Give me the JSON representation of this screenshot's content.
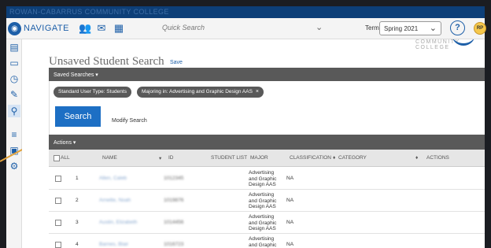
{
  "titlebar": {
    "college": "ROWAN-CABARRUS COMMUNITY COLLEGE"
  },
  "nav": {
    "label": "NAVIGATE",
    "icons": [
      "people-icon",
      "mail-icon",
      "calendar-icon"
    ],
    "quick_search": "Quick Search",
    "terms_label": "Terms",
    "term_value": "Spring 2021",
    "help": "?",
    "avatar": "RP"
  },
  "rail": [
    "dashboard-icon",
    "inbox-icon",
    "history-icon",
    "pin-icon",
    "search-icon",
    "list-icon",
    "reports-icon",
    "settings-icon"
  ],
  "page": {
    "title": "Unsaved Student Search",
    "save": "Save",
    "logo_text": "COMMUNITY COLLEGE",
    "saved_searches": "Saved Searches ▾",
    "chips": [
      {
        "label": "Standard User Type: Students"
      },
      {
        "label": "Majoring in: Advertising and Graphic Design AAS",
        "close": "×"
      }
    ],
    "search_button": "Search",
    "modify_search": "Modify Search",
    "actions": "Actions ▾"
  },
  "table": {
    "headers": {
      "all": "ALL",
      "name": "NAME",
      "sort": "▾",
      "id": "ID",
      "student_list": "STUDENT LIST",
      "major": "MAJOR",
      "classification": "CLASSIFICATION",
      "classification_sort": "♦",
      "category": "CATEGORY",
      "category_sort": "♦",
      "actions": "ACTIONS"
    },
    "rows": [
      {
        "num": "1",
        "name": "Allen, Caleb",
        "id": "1012345",
        "major": [
          "Advertising",
          "and Graphic",
          "Design AAS"
        ],
        "classification": "NA"
      },
      {
        "num": "2",
        "name": "Arnette, Noah",
        "id": "1019876",
        "major": [
          "Advertising",
          "and Graphic",
          "Design AAS"
        ],
        "classification": "NA"
      },
      {
        "num": "3",
        "name": "Austin, Elizabeth",
        "id": "1014456",
        "major": [
          "Advertising",
          "and Graphic",
          "Design AAS"
        ],
        "classification": "NA"
      },
      {
        "num": "4",
        "name": "Barnes, Blair",
        "id": "1016723",
        "major": [
          "Advertising",
          "and Graphic"
        ],
        "classification": "NA"
      }
    ]
  }
}
